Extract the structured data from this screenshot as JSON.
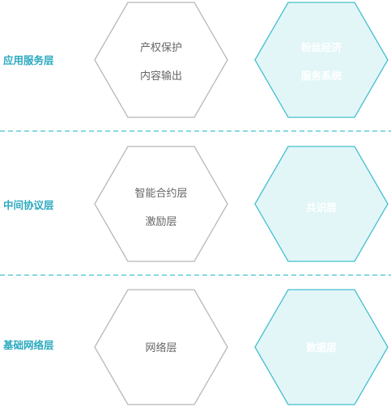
{
  "colors": {
    "accent": "#2aa9bf",
    "left_hex_stroke": "#b8b8b8",
    "left_hex_fill": "#ffffff",
    "left_hex_text": "#666666",
    "right_hex_stroke": "#45bfcf",
    "right_hex_fill": "#e3f6f7",
    "right_hex_text": "#ffffff",
    "divider": "#45bfcf"
  },
  "layers": [
    {
      "label": "应用服务层",
      "left_lines": [
        "产权保护",
        "内容输出"
      ],
      "right_lines": [
        "粉丝经济",
        "服务系统"
      ]
    },
    {
      "label": "中间协议层",
      "left_lines": [
        "智能合约层",
        "激励层"
      ],
      "right_lines": [
        "共识层"
      ]
    },
    {
      "label": "基础网络层",
      "left_lines": [
        "网络层"
      ],
      "right_lines": [
        "数据层"
      ]
    }
  ]
}
